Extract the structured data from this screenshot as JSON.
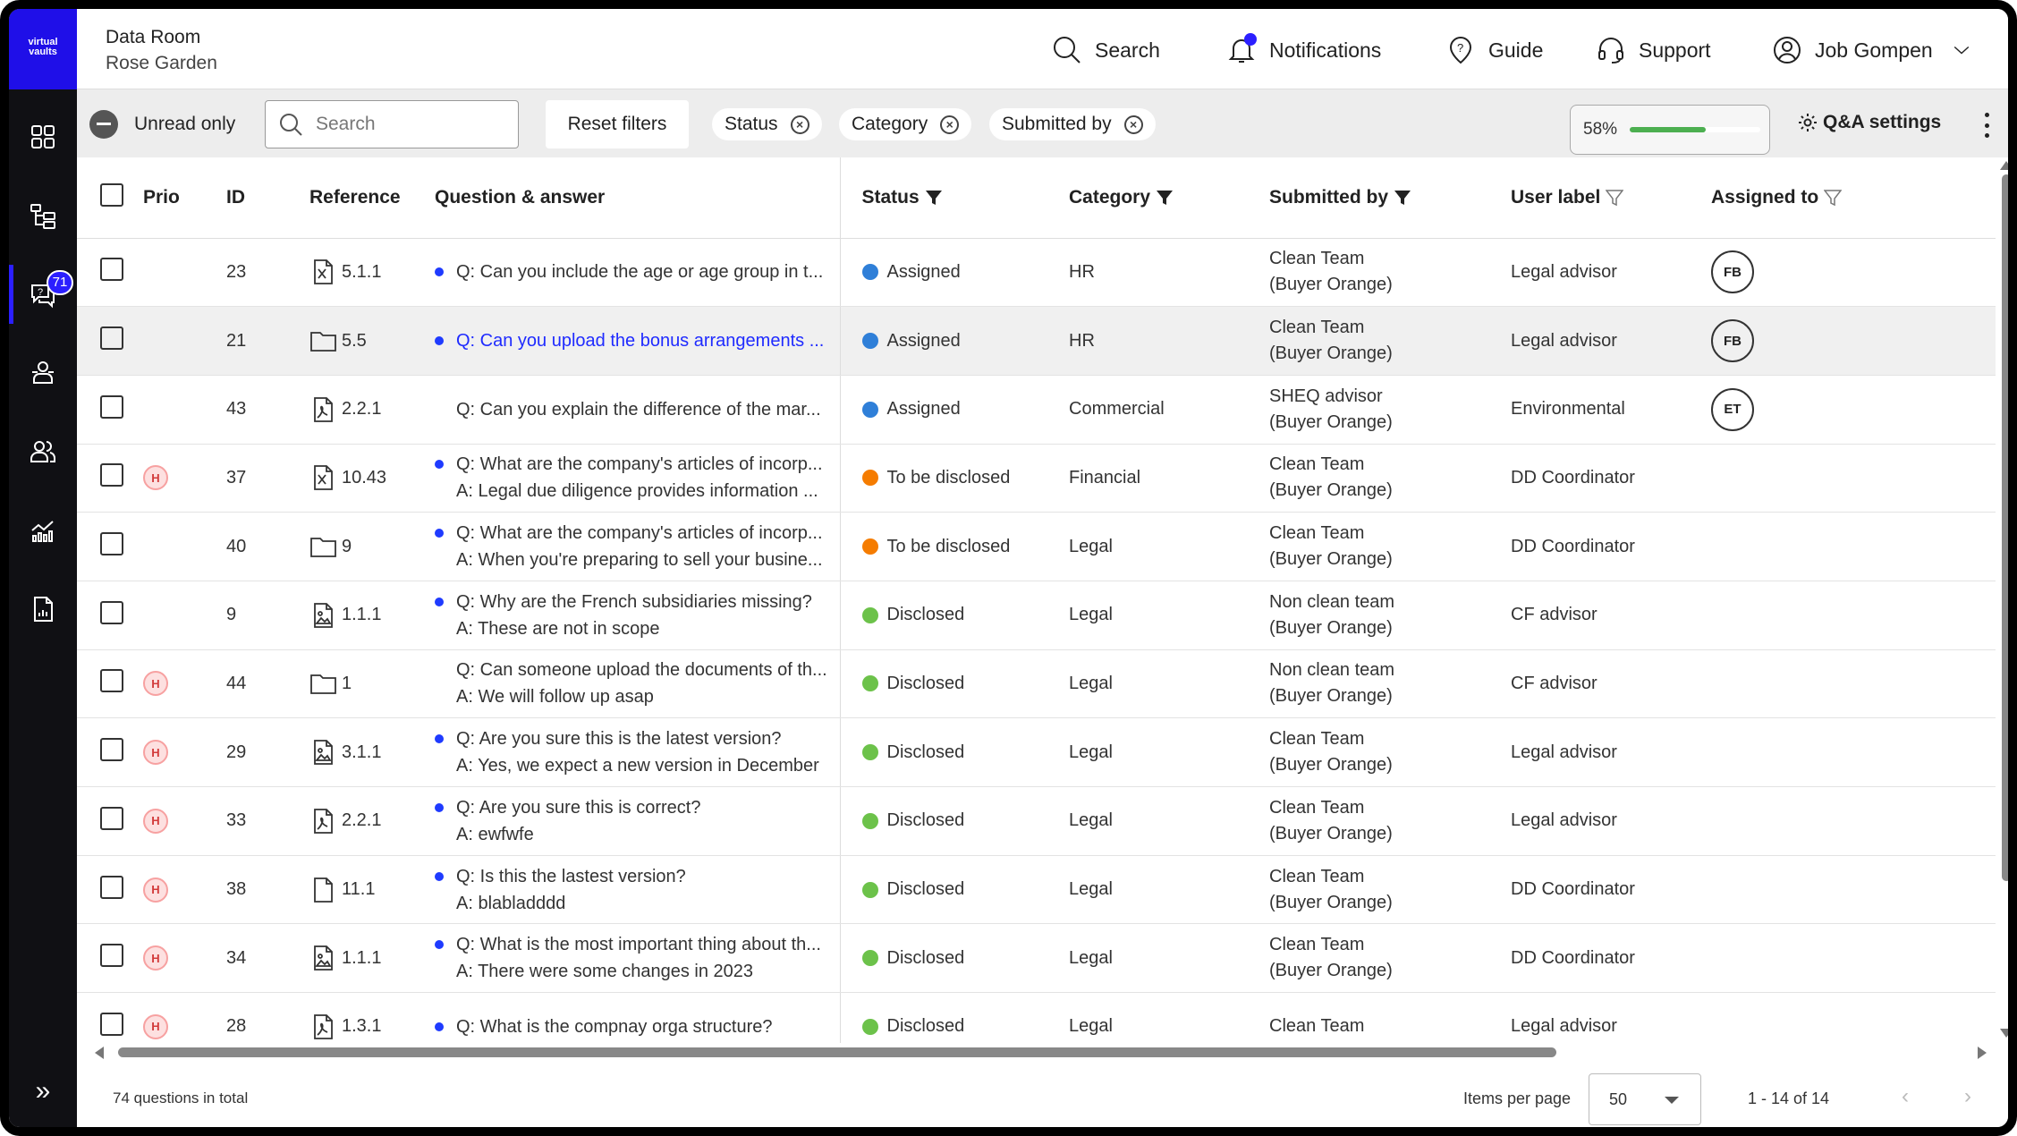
{
  "brand": {
    "logo_text": "virtual vaults",
    "accent": "#1f0fe8"
  },
  "sidebar": {
    "items": [
      {
        "icon": "dashboard-icon"
      },
      {
        "icon": "folder-tree-icon"
      },
      {
        "icon": "qa-chat-icon",
        "badge": "71",
        "active": true
      },
      {
        "icon": "groups-icon"
      },
      {
        "icon": "users-icon"
      },
      {
        "icon": "analytics-icon"
      },
      {
        "icon": "report-icon"
      }
    ],
    "expand_icon": "»"
  },
  "header": {
    "room_title": "Data Room",
    "room_subtitle": "Rose Garden",
    "search_label": "Search",
    "notifications_label": "Notifications",
    "guide_label": "Guide",
    "support_label": "Support",
    "user_name": "Job Gompen"
  },
  "toolbar": {
    "unread_label": "Unread only",
    "search_placeholder": "Search",
    "reset_label": "Reset filters",
    "chips": [
      "Status",
      "Category",
      "Submitted by"
    ],
    "progress_label": "58%",
    "progress_value": 0.58,
    "progress_color": "#4caf50",
    "settings_label": "Q&A settings"
  },
  "table": {
    "headers": {
      "prio": "Prio",
      "id": "ID",
      "reference": "Reference",
      "qa": "Question & answer",
      "status": "Status",
      "category": "Category",
      "submitted": "Submitted by",
      "label": "User label",
      "assigned": "Assigned to"
    },
    "status_colors": {
      "Assigned": "#2f7fd8",
      "To be disclosed": "#f57c00",
      "Disclosed": "#6cc24a"
    },
    "rows": [
      {
        "prio": "",
        "id": "23",
        "ref_icon": "excel-file-icon",
        "ref": "5.1.1",
        "unread": true,
        "q": "Q: Can you include the age or age group in t...",
        "a": "",
        "status": "Assigned",
        "category": "HR",
        "sub1": "Clean Team",
        "sub2": "(Buyer Orange)",
        "label": "Legal advisor",
        "assigned": "FB"
      },
      {
        "prio": "",
        "id": "21",
        "ref_icon": "folder-icon",
        "ref": "5.5",
        "unread": true,
        "link": true,
        "highlight": true,
        "q": "Q: Can you upload the bonus arrangements ...",
        "a": "",
        "status": "Assigned",
        "category": "HR",
        "sub1": "Clean Team",
        "sub2": "(Buyer Orange)",
        "label": "Legal advisor",
        "assigned": "FB"
      },
      {
        "prio": "",
        "id": "43",
        "ref_icon": "pdf-file-icon",
        "ref": "2.2.1",
        "unread": false,
        "q": "Q: Can you explain the difference of the mar...",
        "a": "",
        "status": "Assigned",
        "category": "Commercial",
        "sub1": "SHEQ advisor",
        "sub2": "(Buyer Orange)",
        "label": "Environmental",
        "assigned": "ET"
      },
      {
        "prio": "H",
        "id": "37",
        "ref_icon": "excel-file-icon",
        "ref": "10.43",
        "unread": true,
        "q": "Q: What are the company's articles of incorp...",
        "a": "A: Legal due diligence provides information ...",
        "status": "To be disclosed",
        "category": "Financial",
        "sub1": "Clean Team",
        "sub2": "(Buyer Orange)",
        "label": "DD Coordinator",
        "assigned": ""
      },
      {
        "prio": "",
        "id": "40",
        "ref_icon": "folder-icon",
        "ref": "9",
        "unread": true,
        "q": "Q: What are the company's articles of incorp...",
        "a": "A: When you're preparing to sell your busine...",
        "status": "To be disclosed",
        "category": "Legal",
        "sub1": "Clean Team",
        "sub2": "(Buyer Orange)",
        "label": "DD Coordinator",
        "assigned": ""
      },
      {
        "prio": "",
        "id": "9",
        "ref_icon": "image-file-icon",
        "ref": "1.1.1",
        "unread": true,
        "q": "Q: Why are the French subsidiaries missing?",
        "a": "A: These are not in scope",
        "status": "Disclosed",
        "category": "Legal",
        "sub1": "Non clean team",
        "sub2": "(Buyer Orange)",
        "label": "CF advisor",
        "assigned": ""
      },
      {
        "prio": "H",
        "id": "44",
        "ref_icon": "folder-icon",
        "ref": "1",
        "unread": false,
        "q": "Q: Can someone upload the documents of th...",
        "a": "A: We will follow up asap",
        "status": "Disclosed",
        "category": "Legal",
        "sub1": "Non clean team",
        "sub2": "(Buyer Orange)",
        "label": "CF advisor",
        "assigned": ""
      },
      {
        "prio": "H",
        "id": "29",
        "ref_icon": "image-file-icon",
        "ref": "3.1.1",
        "unread": true,
        "q": "Q: Are you sure this is the latest version?",
        "a": "A: Yes, we expect a new version in December",
        "status": "Disclosed",
        "category": "Legal",
        "sub1": "Clean Team",
        "sub2": "(Buyer Orange)",
        "label": "Legal advisor",
        "assigned": ""
      },
      {
        "prio": "H",
        "id": "33",
        "ref_icon": "pdf-file-icon",
        "ref": "2.2.1",
        "unread": true,
        "q": "Q: Are you sure this is correct?",
        "a": "A: ewfwfe",
        "status": "Disclosed",
        "category": "Legal",
        "sub1": "Clean Team",
        "sub2": "(Buyer Orange)",
        "label": "Legal advisor",
        "assigned": ""
      },
      {
        "prio": "H",
        "id": "38",
        "ref_icon": "blank-file-icon",
        "ref": "11.1",
        "unread": true,
        "q": "Q: Is this the lastest version?",
        "a": "A: blabladddd",
        "status": "Disclosed",
        "category": "Legal",
        "sub1": "Clean Team",
        "sub2": "(Buyer Orange)",
        "label": "DD Coordinator",
        "assigned": ""
      },
      {
        "prio": "H",
        "id": "34",
        "ref_icon": "image-file-icon",
        "ref": "1.1.1",
        "unread": true,
        "q": "Q: What is the most important thing about th...",
        "a": "A: There were some changes in 2023",
        "status": "Disclosed",
        "category": "Legal",
        "sub1": "Clean Team",
        "sub2": "(Buyer Orange)",
        "label": "DD Coordinator",
        "assigned": ""
      },
      {
        "prio": "H",
        "id": "28",
        "ref_icon": "pdf-file-icon",
        "ref": "1.3.1",
        "unread": true,
        "q": "Q: What is the compnay orga structure?",
        "a": "",
        "status": "Disclosed",
        "category": "Legal",
        "sub1": "Clean Team",
        "sub2": "",
        "label": "Legal advisor",
        "assigned": ""
      }
    ]
  },
  "footer": {
    "total": "74 questions in total",
    "items_per_page_label": "Items per page",
    "items_per_page": "50",
    "range": "1 - 14 of 14"
  }
}
